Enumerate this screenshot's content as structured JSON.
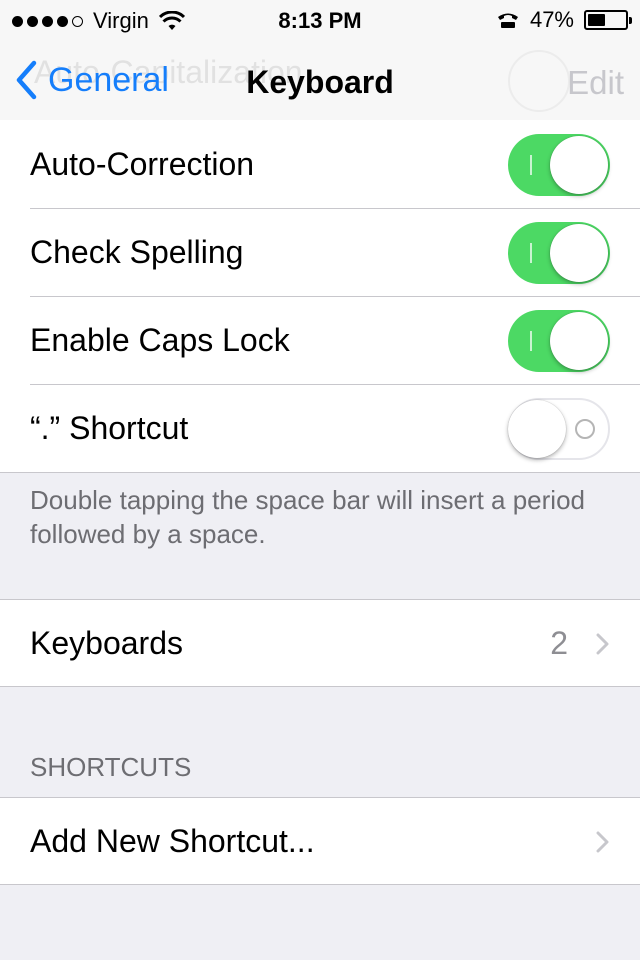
{
  "status_bar": {
    "carrier": "Virgin",
    "time": "8:13 PM",
    "battery": "47%",
    "battery_level": 0.47,
    "signal_dots_filled": 4,
    "signal_dots_total": 5
  },
  "nav": {
    "back_label": "General",
    "title": "Keyboard",
    "edit_label": "Edit",
    "ghost_text": "Auto-Capitalization"
  },
  "settings": {
    "auto_correction": {
      "label": "Auto-Correction",
      "on": true
    },
    "check_spelling": {
      "label": "Check Spelling",
      "on": true
    },
    "caps_lock": {
      "label": "Enable Caps Lock",
      "on": true
    },
    "period_shortcut": {
      "label": "“.” Shortcut",
      "on": false
    }
  },
  "period_note": "Double tapping the space bar will insert a period followed by a space.",
  "keyboards": {
    "label": "Keyboards",
    "value": "2"
  },
  "shortcuts": {
    "header": "SHORTCUTS",
    "add_label": "Add New Shortcut..."
  },
  "colors": {
    "accent": "#157efb",
    "switch_on": "#4cd964",
    "background": "#efeff4"
  }
}
